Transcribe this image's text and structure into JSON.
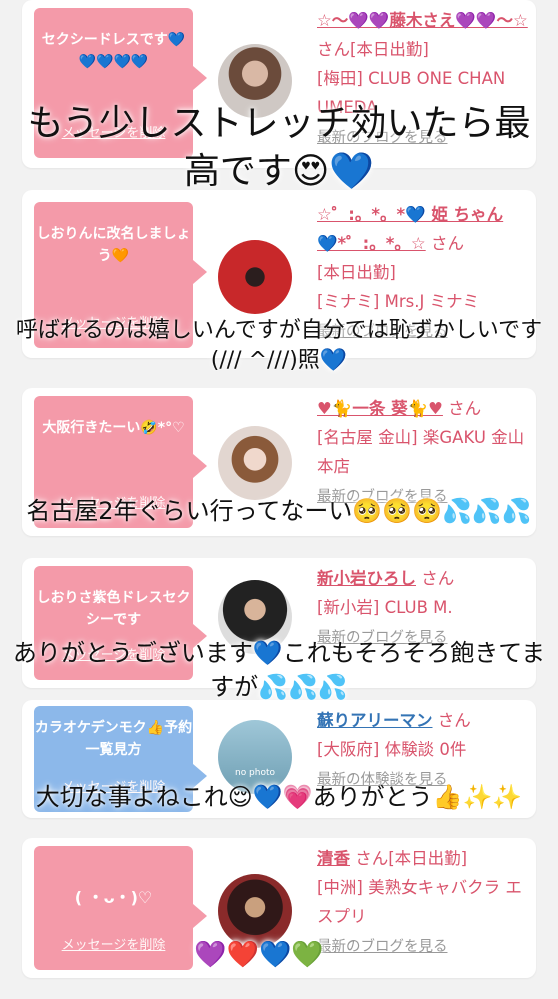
{
  "cards": [
    {
      "bubble": "セクシードレスです💙💙💙💙💙",
      "delete_label": "メッセージを削除",
      "name": "☆〜💜💜藤木さえ💜💜〜☆",
      "suffix": "さん[本日出勤]",
      "shop": "[梅田] CLUB ONE CHAN UMEDA",
      "blog": "最新のブログを見る"
    },
    {
      "bubble": "しおりんに改名しましょう🧡",
      "delete_label": "メッセージを削除",
      "name": "☆゜:。*。*💙 姫 ちゃん 💙*゜:。*。☆",
      "suffix": "さん",
      "status": "[本日出勤]",
      "shop": "[ミナミ] Mrs.J ミナミ",
      "blog": "最新のブログを見る"
    },
    {
      "bubble": "大阪行きたーい🤣*°♡",
      "delete_label": "メッセージを削除",
      "name": "♥🐈一条 葵🐈♥",
      "suffix": "さん",
      "shop": "[名古屋 金山] 楽GAKU 金山本店",
      "blog": "最新のブログを見る"
    },
    {
      "bubble": "しおりさ紫色ドレスセクシーです",
      "delete_label": "メッセージを削除",
      "name": "新小岩ひろし",
      "suffix": "さん",
      "shop": "[新小岩] CLUB M.",
      "blog": "最新のブログを見る"
    },
    {
      "bubble": "カラオケデンモク👍予約一覧見方",
      "delete_label": "メッセージを削除",
      "name": "蘇りアリーマン",
      "suffix": "さん",
      "shop": "[大阪府] 体験談 0件",
      "blog": "最新の体験談を見る",
      "avatar_label": "no photo"
    },
    {
      "bubble": "( ・ᴗ・)♡",
      "delete_label": "メッセージを削除",
      "name": "清香",
      "suffix": "さん[本日出勤]",
      "shop": "[中洲] 美熟女キャバクラ エスプリ",
      "blog": "最新のブログを見る"
    }
  ],
  "overlays": {
    "o1": "もう少しストレッチ効いたら最高です😍💙",
    "o2": "呼ばれるのは嬉しいんですが自分では恥ずかしいです(/// ^///)照💙",
    "o3": "名古屋2年ぐらい行ってなーい🥺🥺🥺💦💦💦",
    "o4": "ありがとうございます💙これもそろそろ飽きてますが💦💦💦",
    "o5": "大切な事よねこれ😌💙💗ありがとう👍✨✨",
    "o6": "💜❤️💙💚"
  },
  "colors": {
    "pink_bubble": "#f49aa9",
    "blue_bubble": "#8cb8ea",
    "name_pink": "#d9546c",
    "name_blue": "#3474b5"
  }
}
